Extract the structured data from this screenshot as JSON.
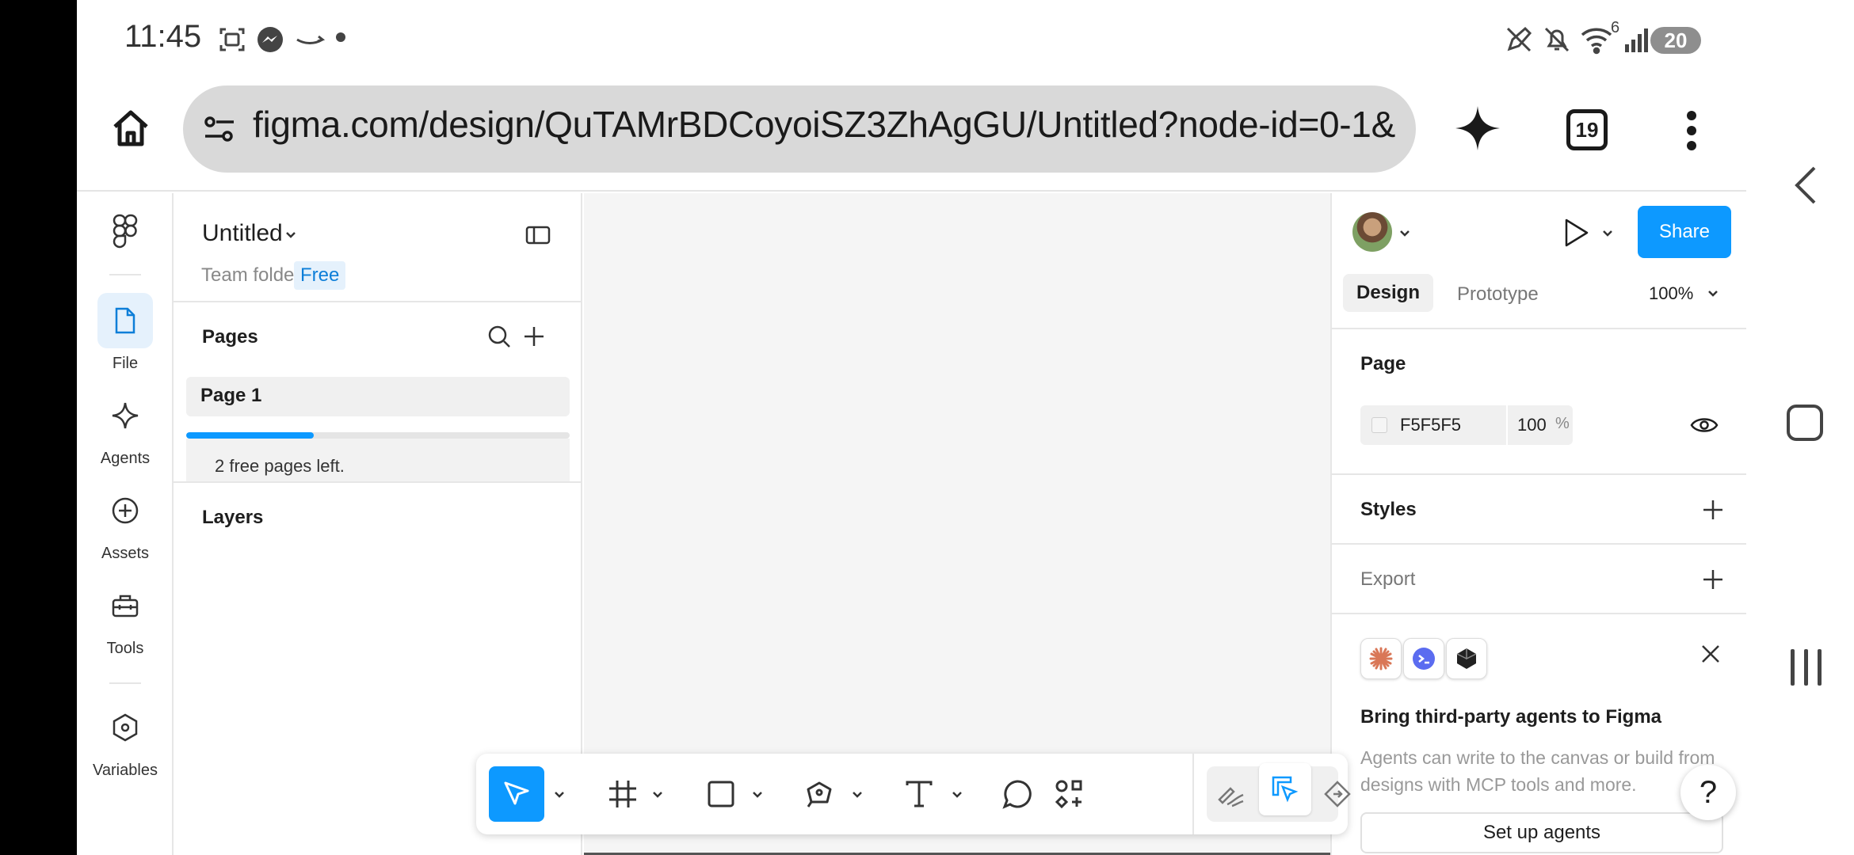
{
  "status_bar": {
    "time": "11:45",
    "wifi_badge": "6",
    "battery": "20",
    "icons": [
      "screenshot-icon",
      "messenger-icon",
      "amazon-icon",
      "dot-icon",
      "pen-off-icon",
      "mute-icon",
      "wifi-icon",
      "signal-icon",
      "battery-icon"
    ]
  },
  "browser": {
    "url": "figma.com/design/QuTAMrBDCoyoiSZ3ZhAgGU/Untitled?node-id=0-1&",
    "tab_count": "19",
    "icons": [
      "home-icon",
      "site-settings-icon",
      "gemini-sparkle-icon",
      "tabs-icon",
      "more-vert-icon"
    ]
  },
  "rail": {
    "items": [
      {
        "label": "File",
        "icon": "file-icon",
        "active": true
      },
      {
        "label": "Agents",
        "icon": "agents-sparkle-icon",
        "active": false
      },
      {
        "label": "Assets",
        "icon": "assets-plus-icon",
        "active": false
      },
      {
        "label": "Tools",
        "icon": "toolbox-icon",
        "active": false
      },
      {
        "label": "Variables",
        "icon": "hexagon-icon",
        "active": false
      }
    ]
  },
  "left_panel": {
    "file_name": "Untitled",
    "team_folder": "Team folder",
    "plan_badge": "Free",
    "pages_label": "Pages",
    "pages": [
      {
        "name": "Page 1",
        "selected": true
      }
    ],
    "free_pages_used_fraction": 0.333,
    "free_pages_text": "2 free pages left.",
    "layers_label": "Layers"
  },
  "right_panel": {
    "share_label": "Share",
    "tabs": [
      {
        "label": "Design",
        "active": true
      },
      {
        "label": "Prototype",
        "active": false
      }
    ],
    "zoom": "100%",
    "page_section": "Page",
    "page_color_hex": "F5F5F5",
    "page_opacity": "100",
    "opacity_unit": "%",
    "styles_label": "Styles",
    "export_label": "Export",
    "promo_title": "Bring third-party agents to Figma",
    "promo_body": "Agents can write to the canvas or build from designs with MCP tools and more.",
    "setup_button": "Set up agents",
    "help": "?",
    "colors": {
      "accent": "#0d99ff",
      "canvas": "#f5f5f5"
    }
  },
  "toolbar": {
    "tools": [
      "move-tool",
      "frame-tool",
      "rectangle-tool",
      "pen-tool",
      "text-tool",
      "comment-tool",
      "actions-tool"
    ],
    "modes": [
      "draw-mode",
      "design-mode",
      "dev-mode",
      "code-mode"
    ],
    "selected_tool": "move-tool",
    "selected_mode": "design-mode"
  },
  "nav_bar": {
    "buttons": [
      "back-icon",
      "home-icon",
      "recents-icon"
    ]
  }
}
